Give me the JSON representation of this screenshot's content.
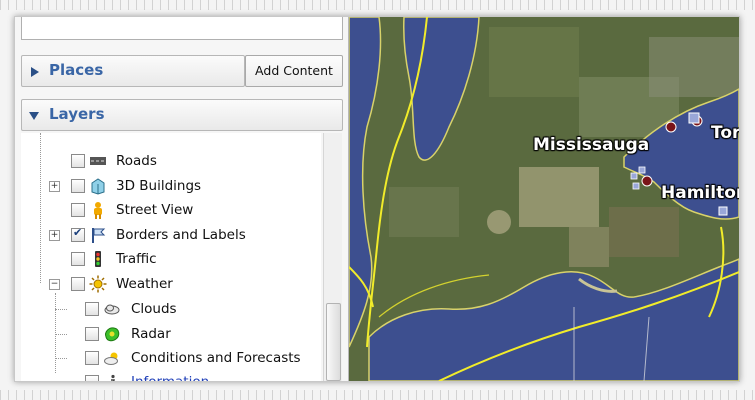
{
  "panel": {
    "places": {
      "title": "Places",
      "add_content_label": "Add Content"
    },
    "layers": {
      "title": "Layers",
      "items": [
        {
          "label": "Roads",
          "checked": false,
          "icon": "road-icon"
        },
        {
          "label": "3D Buildings",
          "checked": false,
          "icon": "buildings-icon",
          "expandable": true
        },
        {
          "label": "Street View",
          "checked": false,
          "icon": "pegman-icon"
        },
        {
          "label": "Borders and Labels",
          "checked": true,
          "icon": "flag-icon",
          "expandable": true
        },
        {
          "label": "Traffic",
          "checked": false,
          "icon": "traffic-light-icon"
        },
        {
          "label": "Weather",
          "checked": false,
          "icon": "sun-icon",
          "expanded": true,
          "children": [
            {
              "label": "Clouds",
              "checked": false,
              "icon": "clouds-icon"
            },
            {
              "label": "Radar",
              "checked": false,
              "icon": "radar-icon"
            },
            {
              "label": "Conditions and Forecasts",
              "checked": false,
              "icon": "forecast-icon"
            },
            {
              "label": "Information",
              "checked": false,
              "icon": "info-icon",
              "link": true
            }
          ]
        }
      ]
    }
  },
  "map": {
    "labels": {
      "mississauga": "Mississauga",
      "toronto": "Toro",
      "hamilton": "Hamilton"
    }
  }
}
